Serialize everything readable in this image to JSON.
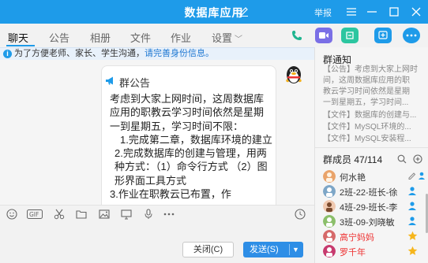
{
  "window": {
    "title": "数据库应用",
    "report_label": "举报"
  },
  "tabs": [
    {
      "label": "聊天"
    },
    {
      "label": "公告"
    },
    {
      "label": "相册"
    },
    {
      "label": "文件"
    },
    {
      "label": "作业"
    },
    {
      "label": "设置"
    }
  ],
  "notice": {
    "text": "为了方便老师、家长、学生沟通，",
    "link": "请完善身份信息。"
  },
  "announcement": {
    "header": "群公告",
    "lines": [
      "考虑到大家上网时间，这周数据库应用的职教云学习时间依然是星期一到星期五，学习时间不限：",
      "1.完成第二章，数据库环境的建立",
      "2.完成数据库的创建与管理，用两种方式：（1）命令行方式 （2）图形界面工具方式",
      "3.作业在职教云已布置，作"
    ]
  },
  "buttons": {
    "close": "关闭(C)",
    "send": "发送(S)"
  },
  "group_notice": {
    "title": "群通知",
    "items": [
      "【公告】考虑到大家上网时",
      "间，这周数据库应用的职",
      "教云学习时间依然是星期",
      "一到星期五，学习时间...",
      "【文件】数据库的创建与...",
      "【文件】MySQL环境的...",
      "【文件】MySQL安装程..."
    ]
  },
  "members": {
    "title": "群成员 47/114",
    "list": [
      {
        "name": "何水艳",
        "red": false,
        "badge": "edit"
      },
      {
        "name": "2班-22-班长-徐",
        "red": false,
        "badge": "person"
      },
      {
        "name": "4班-29-班长-李",
        "red": false,
        "badge": "person"
      },
      {
        "name": "3班-09-刘晓敏",
        "red": false,
        "badge": "person"
      },
      {
        "name": "高宁妈妈",
        "red": true,
        "badge": "star"
      },
      {
        "name": "罗千年",
        "red": true,
        "badge": "star"
      }
    ]
  },
  "colors": {
    "accent": "#1e9be9",
    "send": "#2e8ee6",
    "member_red": "#ee3333"
  }
}
